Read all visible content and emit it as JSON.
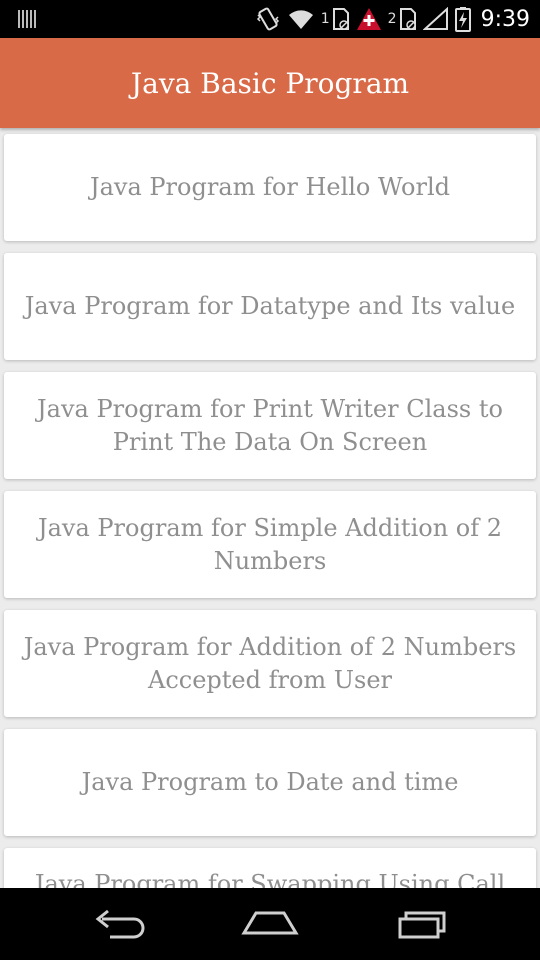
{
  "status_bar": {
    "time": "9:39",
    "sim1_label": "1",
    "sim2_label": "2",
    "icons": [
      "barcode-icon",
      "vibrate-icon",
      "wifi-icon",
      "sim1-icon",
      "alert-icon",
      "sim2-icon",
      "signal-icon",
      "battery-icon"
    ],
    "alert_color": "#c8102e"
  },
  "app_bar": {
    "title": "Java Basic Program",
    "color": "#d96a48"
  },
  "programs": [
    "Java Program for Hello World",
    "Java Program for Datatype and Its value",
    "Java Program for Print Writer Class to Print The Data On Screen",
    "Java Program for Simple Addition of 2 Numbers",
    "Java Program for Addition of 2 Numbers Accepted from User",
    "Java Program to Date and time",
    "Java Program for Swapping Using Call by"
  ],
  "nav_bar": {
    "icons": [
      "back-icon",
      "home-icon",
      "recents-icon"
    ]
  }
}
